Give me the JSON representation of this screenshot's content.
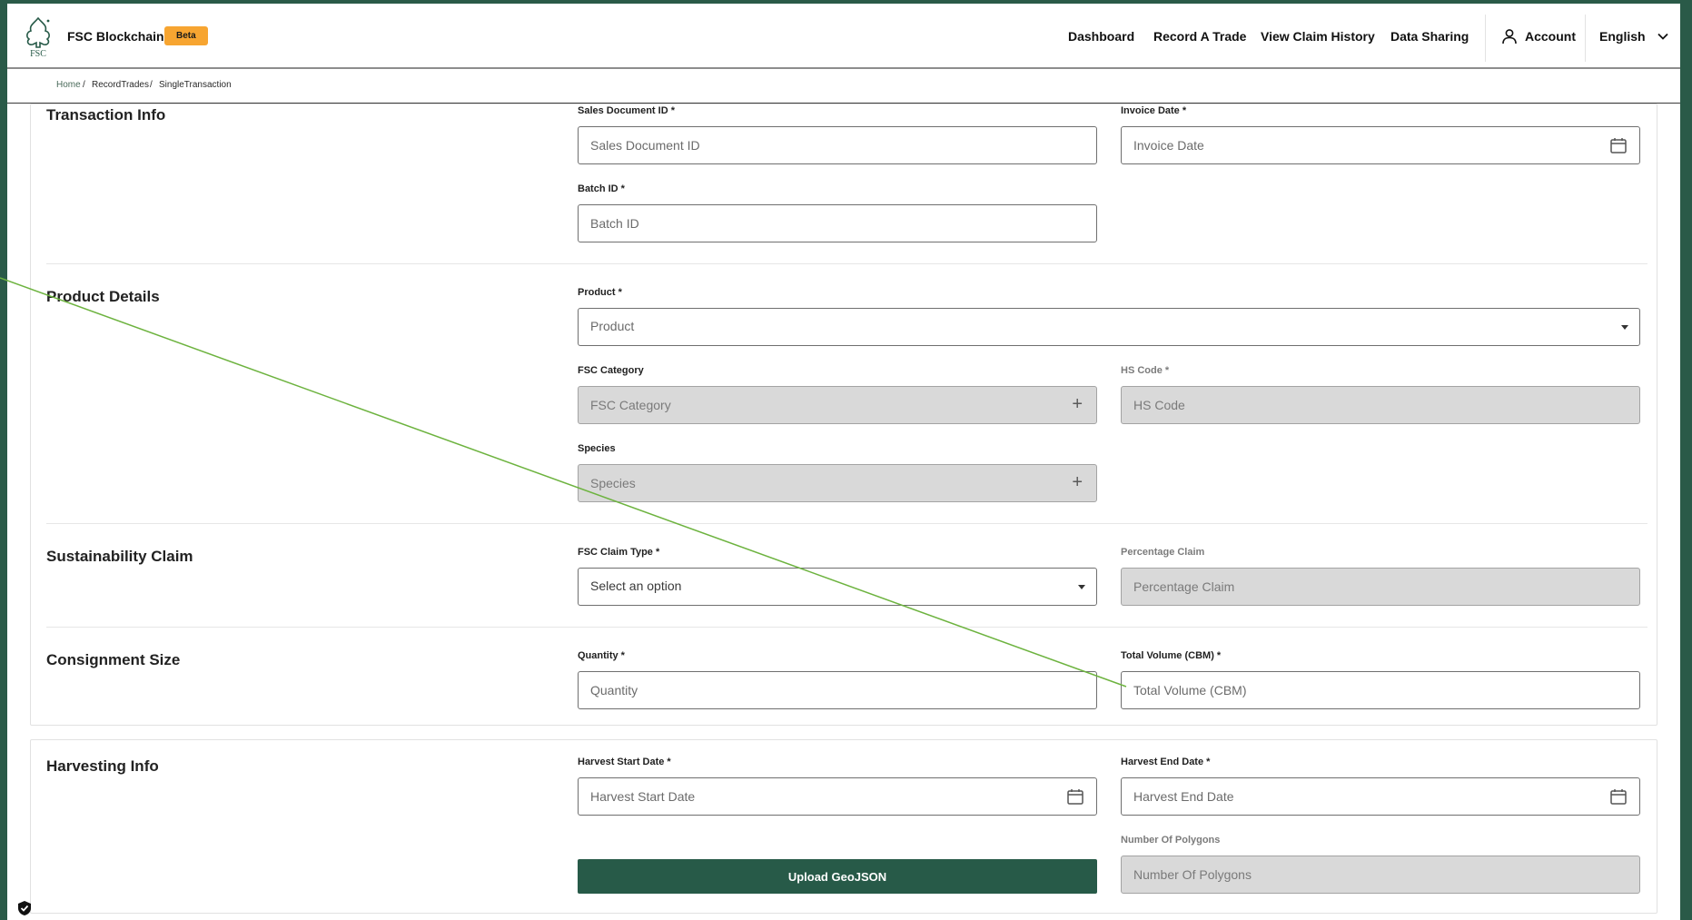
{
  "header": {
    "brand": "FSC Blockchain",
    "badge": "Beta",
    "logo_text": "FSC",
    "nav": {
      "dashboard": "Dashboard",
      "record_trade": "Record A Trade",
      "claim_history": "View Claim History",
      "data_sharing": "Data Sharing",
      "account": "Account",
      "language": "English"
    }
  },
  "breadcrumb": {
    "home": "Home",
    "sep1": "/",
    "record_trades": "RecordTrades",
    "sep2": "/",
    "current": "SingleTransaction"
  },
  "sections": {
    "transaction": {
      "title": "Transaction Info",
      "sales_doc_label": "Sales Document ID *",
      "sales_doc_placeholder": "Sales Document ID",
      "invoice_date_label": "Invoice Date *",
      "invoice_date_placeholder": "Invoice Date",
      "batch_id_label": "Batch ID *",
      "batch_id_placeholder": "Batch ID"
    },
    "product": {
      "title": "Product Details",
      "product_label": "Product *",
      "product_value": "Product",
      "fsc_category_label": "FSC Category",
      "fsc_category_placeholder": "FSC Category",
      "hs_code_label": "HS Code *",
      "hs_code_placeholder": "HS Code",
      "species_label": "Species",
      "species_placeholder": "Species"
    },
    "sustainability": {
      "title": "Sustainability Claim",
      "claim_type_label": "FSC Claim Type *",
      "claim_type_value": "Select an option",
      "percentage_label": "Percentage Claim",
      "percentage_placeholder": "Percentage Claim"
    },
    "consignment": {
      "title": "Consignment Size",
      "quantity_label": "Quantity *",
      "quantity_placeholder": "Quantity",
      "volume_label": "Total Volume (CBM) *",
      "volume_placeholder": "Total Volume (CBM)"
    },
    "harvesting": {
      "title": "Harvesting Info",
      "start_label": "Harvest Start Date *",
      "start_placeholder": "Harvest Start Date",
      "end_label": "Harvest End Date *",
      "end_placeholder": "Harvest End Date",
      "polygons_label": "Number Of Polygons",
      "polygons_placeholder": "Number Of Polygons",
      "upload_label": "Upload GeoJSON"
    }
  },
  "colors": {
    "brand_green": "#275a48",
    "beta_badge": "#f7a531",
    "disabled_field": "#d9d9d9",
    "annotation_line": "#6db33f"
  },
  "icons": [
    "fsc-tree-logo",
    "user-icon",
    "chevron-down-icon",
    "calendar-icon",
    "plus-icon",
    "caret-down-icon",
    "shield-check-icon"
  ]
}
